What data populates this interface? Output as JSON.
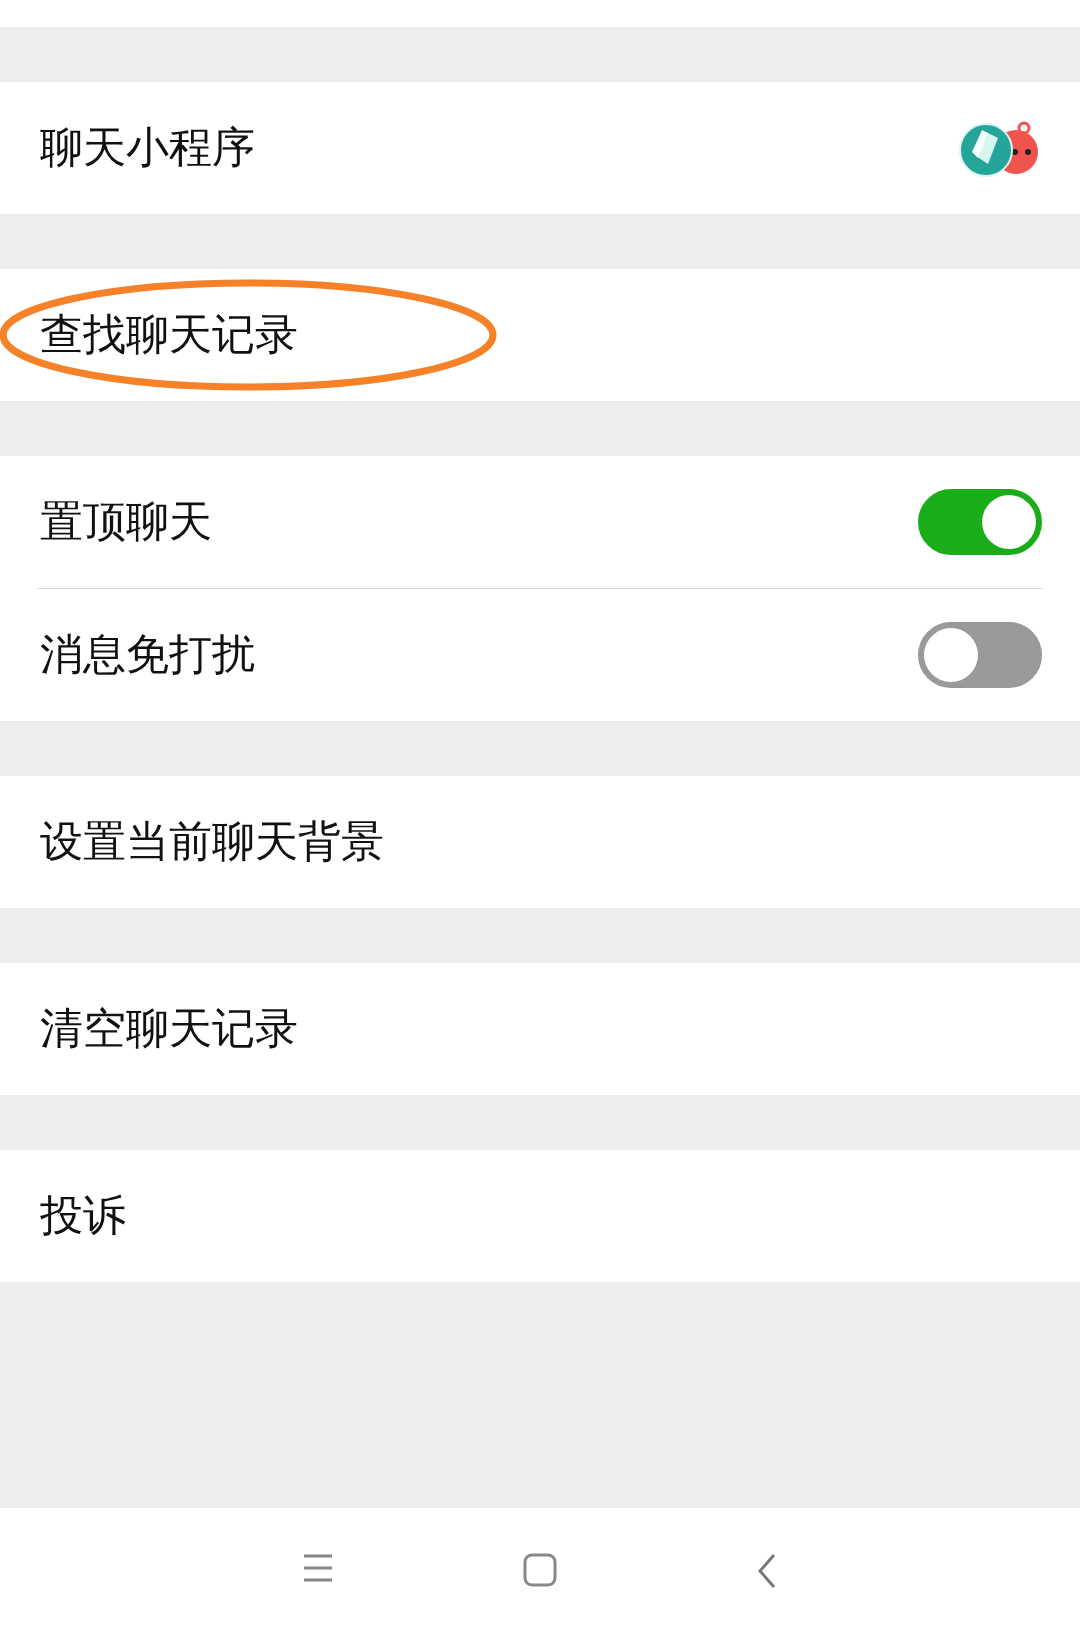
{
  "groups": [
    {
      "items": [
        {
          "kind": "mini-programs",
          "label": "聊天小程序"
        }
      ]
    },
    {
      "items": [
        {
          "kind": "plain",
          "label": "查找聊天记录",
          "highlighted": true
        }
      ]
    },
    {
      "items": [
        {
          "kind": "toggle",
          "label": "置顶聊天",
          "on": true
        },
        {
          "kind": "toggle",
          "label": "消息免打扰",
          "on": false
        }
      ]
    },
    {
      "items": [
        {
          "kind": "plain",
          "label": "设置当前聊天背景",
          "highlighted": false
        }
      ]
    },
    {
      "items": [
        {
          "kind": "plain",
          "label": "清空聊天记录",
          "highlighted": false
        }
      ]
    },
    {
      "items": [
        {
          "kind": "plain",
          "label": "投诉",
          "highlighted": false
        }
      ]
    }
  ]
}
